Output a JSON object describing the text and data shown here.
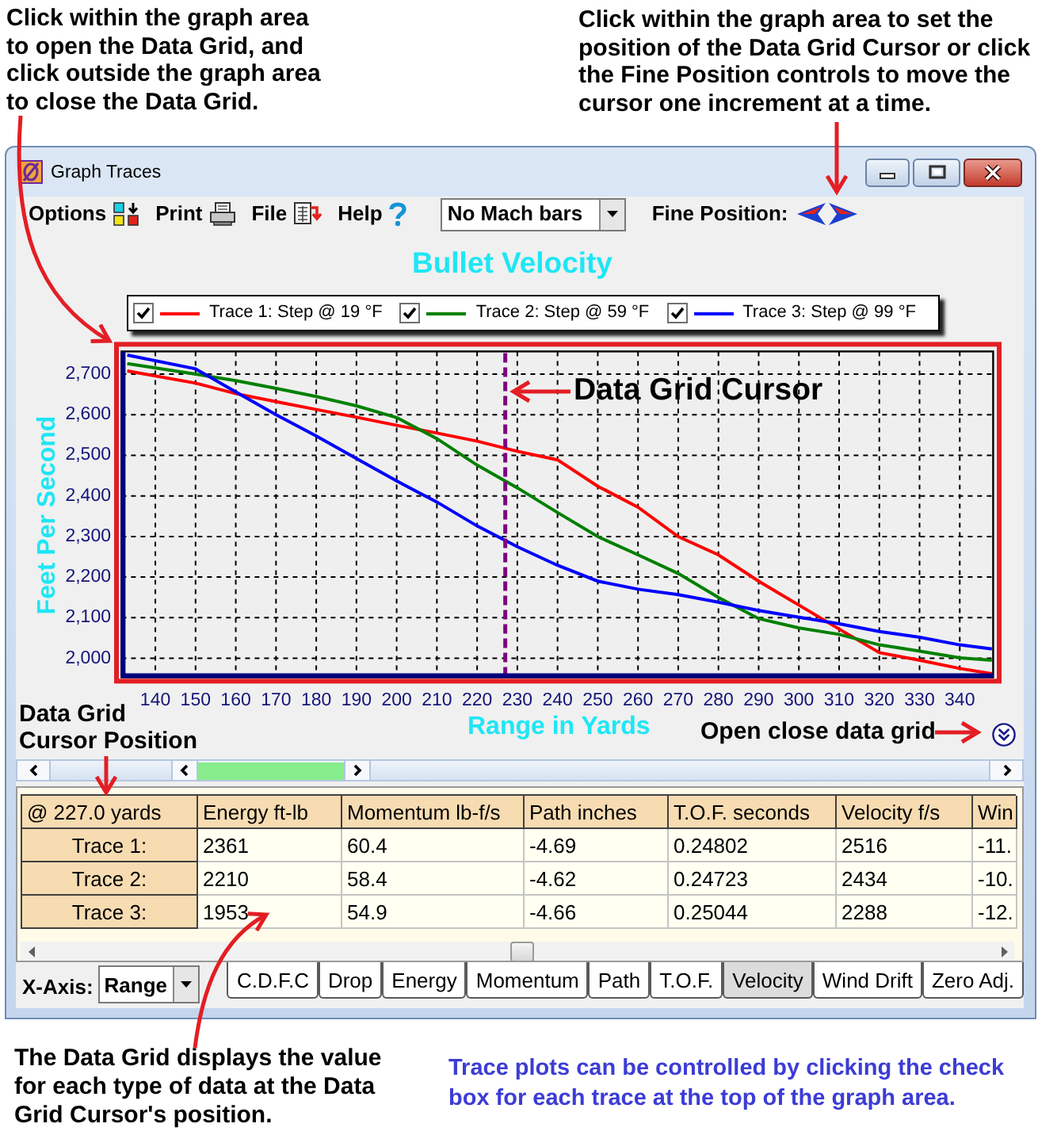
{
  "annotations": {
    "top_left": "Click within the graph area\nto open the Data Grid, and\nclick outside the graph area\nto close the Data Grid.",
    "top_right": "Click within the graph area to set the\nposition of the Data Grid Cursor or click\nthe Fine Position controls to move the\ncursor one increment at a time.",
    "cursor": "Data Grid Cursor",
    "cursor_position": "Data Grid\nCursor Position",
    "open_close": "Open close data grid",
    "bottom_left": "The Data Grid displays the value\nfor each type of data at the Data\nGrid Cursor's position.",
    "bottom_right": "Trace plots can be controlled by clicking the check\nbox for each trace at the top of the graph area."
  },
  "window": {
    "title": "Graph Traces"
  },
  "toolbar": {
    "menus": [
      {
        "kind": "options",
        "label": "Options"
      },
      {
        "kind": "print",
        "label": "Print"
      },
      {
        "kind": "file",
        "label": "File"
      },
      {
        "kind": "help",
        "label": "Help"
      }
    ],
    "mach_bars": {
      "value": "No Mach bars"
    },
    "fine_position": {
      "label": "Fine Position:"
    }
  },
  "graph": {
    "legend_items": [
      {
        "checked": true
      },
      {
        "checked": true
      },
      {
        "checked": true
      }
    ],
    "chart_data": {
      "type": "line",
      "title": "Bullet Velocity",
      "xlabel": "Range in Yards",
      "ylabel": "Feet Per Second",
      "legend": "top",
      "grid": true,
      "x": [
        133,
        150,
        160,
        170,
        180,
        190,
        200,
        210,
        220,
        230,
        240,
        250,
        260,
        270,
        280,
        290,
        300,
        310,
        320,
        330,
        340,
        348
      ],
      "series": [
        {
          "name": "Trace 1: Step @ 19 °F",
          "color": "#ff0000",
          "values": [
            2708,
            2678,
            2652,
            2632,
            2613,
            2594,
            2574,
            2555,
            2535,
            2510,
            2489,
            2424,
            2372,
            2300,
            2255,
            2190,
            2131,
            2072,
            2014,
            1995,
            1975,
            1962
          ]
        },
        {
          "name": "Trace 2: Step @ 59 °F",
          "color": "#008000",
          "values": [
            2726,
            2700,
            2684,
            2665,
            2645,
            2622,
            2593,
            2541,
            2476,
            2420,
            2359,
            2300,
            2255,
            2209,
            2150,
            2098,
            2075,
            2059,
            2033,
            2018,
            2001,
            1995
          ]
        },
        {
          "name": "Trace 3: Step @ 99 °F",
          "color": "#0000ff",
          "values": [
            2747,
            2713,
            2656,
            2600,
            2548,
            2492,
            2437,
            2385,
            2326,
            2275,
            2229,
            2190,
            2170,
            2157,
            2138,
            2118,
            2101,
            2085,
            2066,
            2052,
            2033,
            2023
          ]
        }
      ],
      "xlim": [
        131.6,
        348.3
      ],
      "ylim": [
        1953,
        2756
      ],
      "xticks": [
        140,
        150,
        160,
        170,
        180,
        190,
        200,
        210,
        220,
        230,
        240,
        250,
        260,
        270,
        280,
        290,
        300,
        310,
        320,
        330,
        340
      ],
      "yticks": [
        {
          "value": 2000,
          "label": "2,000"
        },
        {
          "value": 2100,
          "label": "2,100"
        },
        {
          "value": 2200,
          "label": "2,200"
        },
        {
          "value": 2300,
          "label": "2,300"
        },
        {
          "value": 2400,
          "label": "2,400"
        },
        {
          "value": 2500,
          "label": "2,500"
        },
        {
          "value": 2600,
          "label": "2,600"
        },
        {
          "value": 2700,
          "label": "2,700"
        }
      ],
      "ref_lines": [
        {
          "axis": "x",
          "value": 227,
          "color": "#800080"
        }
      ]
    }
  },
  "data_grid": {
    "columns": [
      "@ 227.0 yards",
      "Energy ft-lb",
      "Momentum lb-f/s",
      "Path inches",
      "T.O.F. seconds",
      "Velocity f/s",
      "Win"
    ],
    "rows": [
      {
        "cells": [
          "Trace 1:",
          "2361",
          "60.4",
          "-4.69",
          "0.24802",
          "2516",
          "-11."
        ]
      },
      {
        "cells": [
          "Trace 2:",
          "2210",
          "58.4",
          "-4.62",
          "0.24723",
          "2434",
          "-10."
        ]
      },
      {
        "cells": [
          "Trace 3:",
          "1953",
          "54.9",
          "-4.66",
          "0.25044",
          "2288",
          "-12."
        ]
      }
    ]
  },
  "bottom_bar": {
    "x_axis": {
      "label": "X-Axis:",
      "value": "Range"
    },
    "tabs": [
      {
        "label": "C.D.F.C",
        "selected": false
      },
      {
        "label": "Drop",
        "selected": false
      },
      {
        "label": "Energy",
        "selected": false
      },
      {
        "label": "Momentum",
        "selected": false
      },
      {
        "label": "Path",
        "selected": false
      },
      {
        "label": "T.O.F.",
        "selected": false
      },
      {
        "label": "Velocity",
        "selected": true
      },
      {
        "label": "Wind Drift",
        "selected": false
      },
      {
        "label": "Zero Adj.",
        "selected": false
      }
    ]
  }
}
